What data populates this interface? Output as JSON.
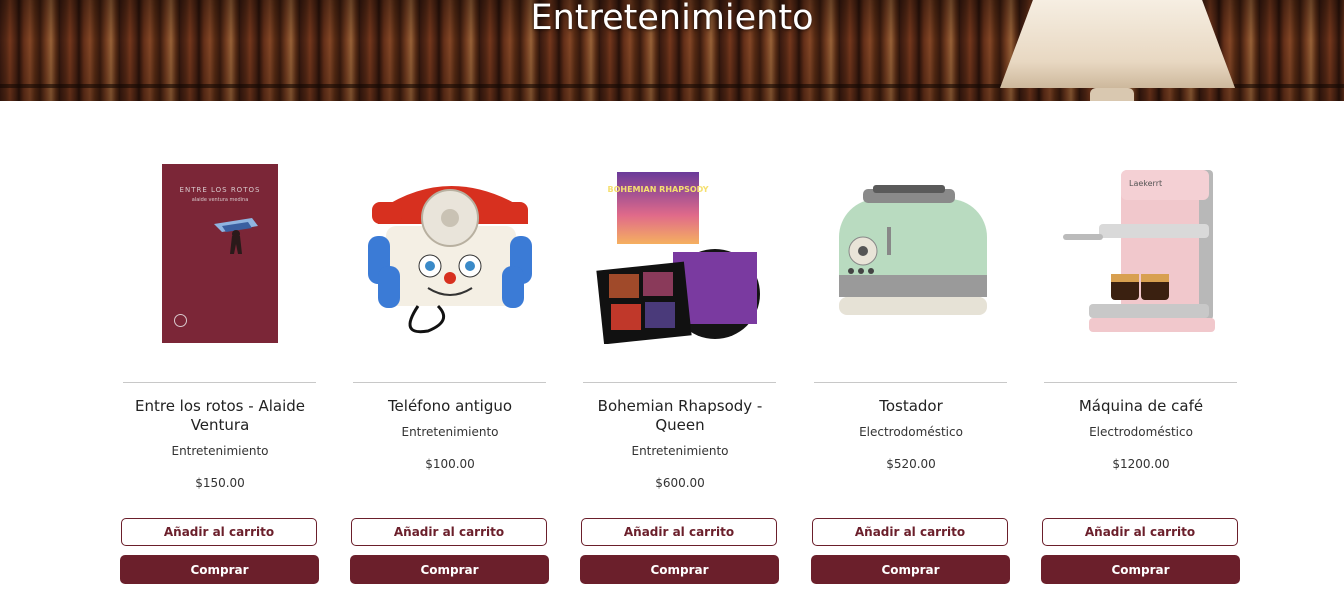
{
  "hero": {
    "title": "Entretenimiento"
  },
  "products": [
    {
      "name": "Entre los rotos - Alaide Ventura",
      "category": "Entretenimiento",
      "price": "$150.00",
      "cart": "Añadir al carrito",
      "buy": "Comprar",
      "icon": "book-image",
      "book_title": "ENTRE LOS ROTOS",
      "book_author": "alaide ventura medina"
    },
    {
      "name": "Teléfono antiguo",
      "category": "Entretenimiento",
      "price": "$100.00",
      "cart": "Añadir al carrito",
      "buy": "Comprar",
      "icon": "toy-phone-image"
    },
    {
      "name": "Bohemian Rhapsody - Queen",
      "category": "Entretenimiento",
      "price": "$600.00",
      "cart": "Añadir al carrito",
      "buy": "Comprar",
      "icon": "vinyl-album-image",
      "album_title": "BOHEMIAN RHAPSODY"
    },
    {
      "name": "Tostador",
      "category": "Electrodoméstico",
      "price": "$520.00",
      "cart": "Añadir al carrito",
      "buy": "Comprar",
      "icon": "toaster-image"
    },
    {
      "name": "Máquina de café",
      "category": "Electrodoméstico",
      "price": "$1200.00",
      "cart": "Añadir al carrito",
      "buy": "Comprar",
      "icon": "espresso-machine-image",
      "brand": "Laekerrt"
    }
  ],
  "colors": {
    "accent": "#6b1f2b",
    "divider": "#c8c8c8"
  }
}
